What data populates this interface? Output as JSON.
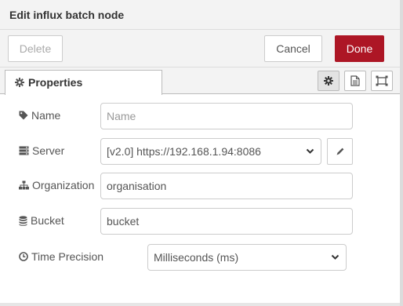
{
  "header": {
    "title": "Edit influx batch node"
  },
  "toolbar": {
    "delete_label": "Delete",
    "cancel_label": "Cancel",
    "done_label": "Done"
  },
  "tabs": {
    "properties_label": "Properties",
    "side_tabs": [
      "gear-icon",
      "document-icon",
      "frame-icon"
    ]
  },
  "form": {
    "name": {
      "label": "Name",
      "value": "",
      "placeholder": "Name"
    },
    "server": {
      "label": "Server",
      "value": "[v2.0] https://192.168.1.94:8086"
    },
    "organization": {
      "label": "Organization",
      "value": "organisation"
    },
    "bucket": {
      "label": "Bucket",
      "value": "bucket"
    },
    "time_precision": {
      "label": "Time Precision",
      "value": "Milliseconds (ms)"
    }
  },
  "colors": {
    "primary": "#ad1625",
    "header_bg": "#f3f3f3",
    "border": "#cccccc"
  }
}
